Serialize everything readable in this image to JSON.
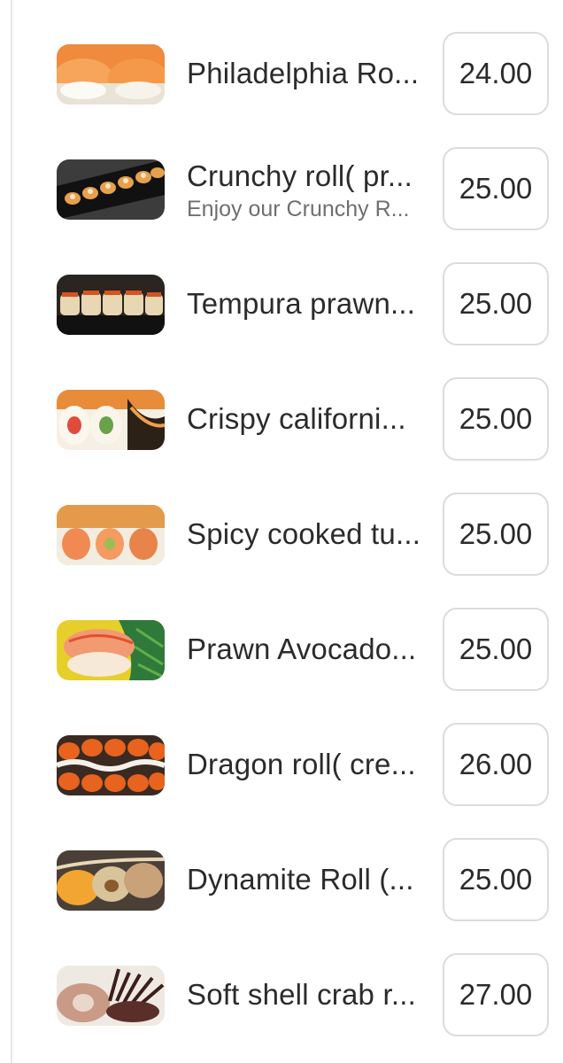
{
  "menu": {
    "items": [
      {
        "name": "Philadelphia Ro...",
        "description": "",
        "price": "24.00",
        "image_icon": "sushi-roll-photo"
      },
      {
        "name": "Crunchy roll( pr...",
        "description": "Enjoy our Crunchy R...",
        "price": "25.00",
        "image_icon": "sushi-roll-photo"
      },
      {
        "name": "Tempura prawn...",
        "description": "",
        "price": "25.00",
        "image_icon": "sushi-roll-photo"
      },
      {
        "name": "Crispy californi...",
        "description": "",
        "price": "25.00",
        "image_icon": "sushi-roll-photo"
      },
      {
        "name": "Spicy cooked tu...",
        "description": "",
        "price": "25.00",
        "image_icon": "sushi-roll-photo"
      },
      {
        "name": "Prawn Avocado...",
        "description": "",
        "price": "25.00",
        "image_icon": "sushi-roll-photo"
      },
      {
        "name": "Dragon roll( cre...",
        "description": "",
        "price": "26.00",
        "image_icon": "sushi-roll-photo"
      },
      {
        "name": "Dynamite Roll (...",
        "description": "",
        "price": "25.00",
        "image_icon": "sushi-roll-photo"
      },
      {
        "name": "Soft shell crab r...",
        "description": "",
        "price": "27.00",
        "image_icon": "sushi-roll-photo"
      }
    ]
  },
  "colors": {
    "text": "#2b2b2b",
    "muted_text": "#6f6f6f",
    "border": "#dcdcdc"
  }
}
